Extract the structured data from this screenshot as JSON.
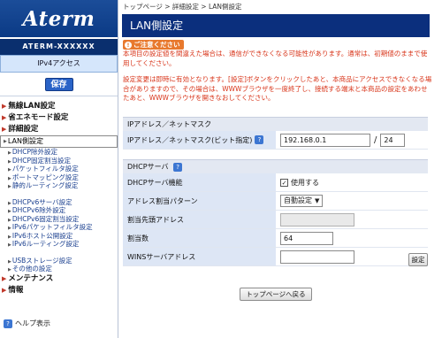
{
  "sidebar": {
    "logo": "Aterm",
    "model": "ATERM-XXXXXX",
    "mode": "IPv4アクセス",
    "save_label": "保存",
    "nav": [
      {
        "label": "無線LAN設定",
        "type": "head"
      },
      {
        "label": "省エネモード設定",
        "type": "head"
      },
      {
        "label": "詳細設定",
        "type": "head"
      },
      {
        "label": "LAN側設定",
        "type": "sub"
      },
      {
        "label": "DHCP除外設定",
        "type": "sub"
      },
      {
        "label": "DHCP固定割当設定",
        "type": "sub"
      },
      {
        "label": "パケットフィルタ設定",
        "type": "sub"
      },
      {
        "label": "ポートマッピング設定",
        "type": "sub"
      },
      {
        "label": "静的ルーティング設定",
        "type": "sub"
      },
      {
        "label": "DHCPv6サーバ設定",
        "type": "sub"
      },
      {
        "label": "DHCPv6除外設定",
        "type": "sub"
      },
      {
        "label": "DHCPv6固定割当設定",
        "type": "sub"
      },
      {
        "label": "IPv6パケットフィルタ設定",
        "type": "sub"
      },
      {
        "label": "IPv6ホスト公開設定",
        "type": "sub"
      },
      {
        "label": "IPv6ルーティング設定",
        "type": "sub"
      },
      {
        "label": "USBストレージ設定",
        "type": "sub"
      },
      {
        "label": "その他の設定",
        "type": "sub"
      },
      {
        "label": "メンテナンス",
        "type": "head"
      },
      {
        "label": "情報",
        "type": "head"
      }
    ],
    "help_label": "ヘルプ表示"
  },
  "breadcrumb": "トップページ > 詳細設定 > LAN側設定",
  "page_title": "LAN側設定",
  "notice": {
    "tag": "ご注意ください",
    "para1": "本項目の設定値を間違えた場合は、通信ができなくなる可能性があります。通常は、初期値のままで使用してください。",
    "para2": "設定変更は即時に有効となります。[設定]ボタンをクリックしたあと、本商品にアクセスできなくなる場合がありますので、その場合は、WWWブラウザを一度終了し、接続する端末と本商品の設定をあわせたあと、WWWブラウザを開きなおしてください。"
  },
  "ip_section": {
    "heading": "IPアドレス／ネットマスク",
    "row_label": "IPアドレス／ネットマスク(ビット指定)",
    "ip_value": "192.168.0.1",
    "separator": "/",
    "mask_value": "24"
  },
  "dhcp_section": {
    "heading": "DHCPサーバ",
    "function_label": "DHCPサーバ機能",
    "function_checkbox_label": "使用する",
    "function_checked": true,
    "pattern_label": "アドレス割当パターン",
    "pattern_value": "自動設定",
    "start_label": "割当先頭アドレス",
    "start_value": "",
    "count_label": "割当数",
    "count_value": "64",
    "wins_label": "WINSサーバアドレス",
    "wins_value": ""
  },
  "buttons": {
    "apply": "設定",
    "back_top": "トップページへ戻る"
  },
  "colors": {
    "title_bar": "#0b2f7d",
    "notice_red": "#d83419",
    "label_cell": "#dde6f5"
  }
}
